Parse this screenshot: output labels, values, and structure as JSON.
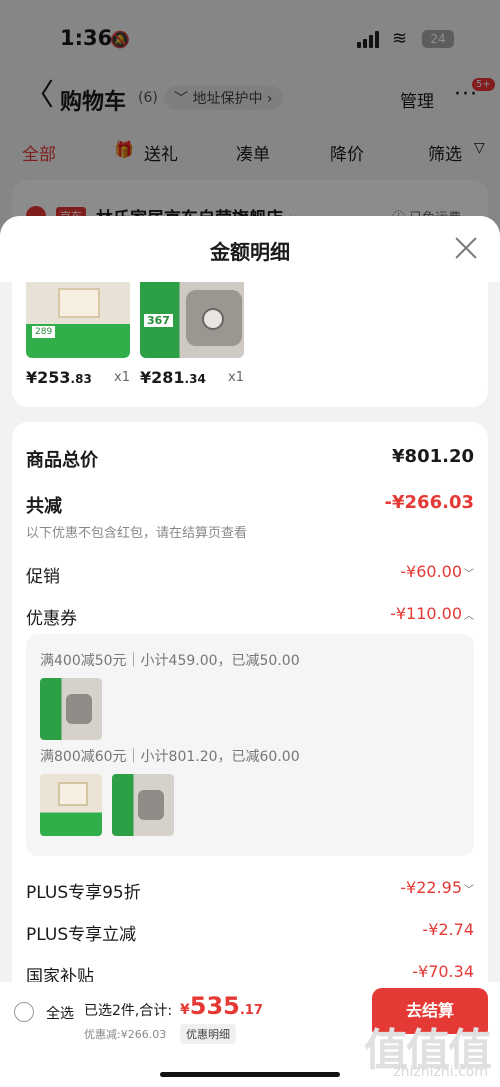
{
  "status": {
    "time": "1:36",
    "battery": "24"
  },
  "cart": {
    "back": "〈",
    "title": "购物车",
    "count": "(6)",
    "address": "﹀ 地址保护中 ›",
    "manage": "管理",
    "more": "···",
    "more_badge": "5+",
    "filters": [
      "全部",
      "送礼",
      "凑单",
      "降价",
      "筛选"
    ],
    "store_tag": "京东",
    "store_name": "林氏家居京东自营旗舰店 ›",
    "store_ship": "ⓘ 已免运费"
  },
  "sheet": {
    "title": "金额明细",
    "products": [
      {
        "price_int": "¥253",
        "price_dec": ".83",
        "qty": "x1",
        "tag": "289"
      },
      {
        "price_int": "¥281",
        "price_dec": ".34",
        "qty": "x1",
        "tag": "367"
      }
    ],
    "total_label": "商品总价",
    "total_value": "¥801.20",
    "reduce_label": "共减",
    "reduce_value": "-¥266.03",
    "reduce_hint": "以下优惠不包含红包，请在结算页查看",
    "promo_label": "促销",
    "promo_value": "-¥60.00",
    "coupon_label": "优惠券",
    "coupon_value": "-¥110.00",
    "coupon_line1": "满400减50元｜小计459.00，已减50.00",
    "coupon_line2": "满800减60元｜小计801.20，已减60.00",
    "plus95_label": "PLUS专享95折",
    "plus95_value": "-¥22.95",
    "plusinstant_label": "PLUS专享立减",
    "plusinstant_value": "-¥2.74",
    "subsidy_label": "国家补贴",
    "subsidy_value": "-¥70.34"
  },
  "bottom": {
    "select_all": "全选",
    "selected": "已选2件,合计:",
    "total_sym": "¥",
    "total_int": "535",
    "total_dec": ".17",
    "discount": "优惠减:¥266.03",
    "detail": "优惠明细",
    "checkout": "去结算"
  },
  "watermark": {
    "logo": "值值值",
    "site": "zhizhizhi.com"
  }
}
